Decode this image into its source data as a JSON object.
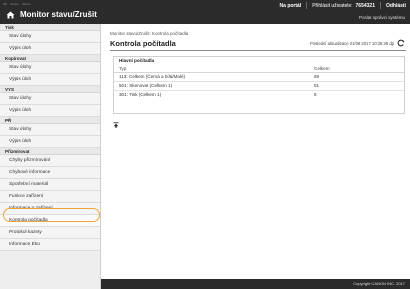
{
  "header": {
    "brand_items": [
      "MF",
      "Series",
      "Series"
    ],
    "title": "Monitor stavu/Zrušit",
    "portal": "Na portál",
    "user_label": "Přihlásit uživatele:",
    "user_id": "7654321",
    "logout": "Odhlásit",
    "admin_email": "Poslat správci systému"
  },
  "sidebar": {
    "groups": [
      {
        "label": "Tisk",
        "items": [
          "Stav úlohy",
          "Výpis úloh"
        ]
      },
      {
        "label": "Kopírovat",
        "items": [
          "Stav úlohy",
          "Výpis úloh"
        ]
      },
      {
        "label": "VYS",
        "items": [
          "Stav úlohy",
          "Výpis úloh"
        ]
      },
      {
        "label": "PŘ",
        "items": [
          "Stav úlohy",
          "Výpis úloh"
        ]
      },
      {
        "label": "Přizmírovat",
        "items": [
          "Chyby přizmírování",
          "Chybové informace",
          "Spotřební materiál",
          "Funkce zařízení",
          "Informace o zařízení",
          "Kontrola počítadla",
          "Protokol kazety",
          "Informace Eko"
        ]
      }
    ],
    "active_item": "Kontrola počítadla"
  },
  "main": {
    "breadcrumb": "Monitor stavu/Zrušit: Kontrola počítadla",
    "title": "Kontrola počítadla",
    "updated": "Poslední aktualizace 21/09 2017 10:35:36 dp",
    "panel_title": "Hlavní počítadla",
    "table": {
      "headers": [
        "Typ",
        "Celkem"
      ],
      "rows": [
        [
          "113: Celkem (Černá a bílá/Malé)",
          "69"
        ],
        [
          "501: Skenovat (Celkem 1)",
          "51"
        ],
        [
          "301: Tisk (Celkem 1)",
          "8"
        ]
      ]
    }
  },
  "footer": {
    "copyright": "Copyright CANON INC. 2017"
  },
  "colors": {
    "topbar": "#2b2b2b",
    "highlight": "#f0a53a"
  }
}
